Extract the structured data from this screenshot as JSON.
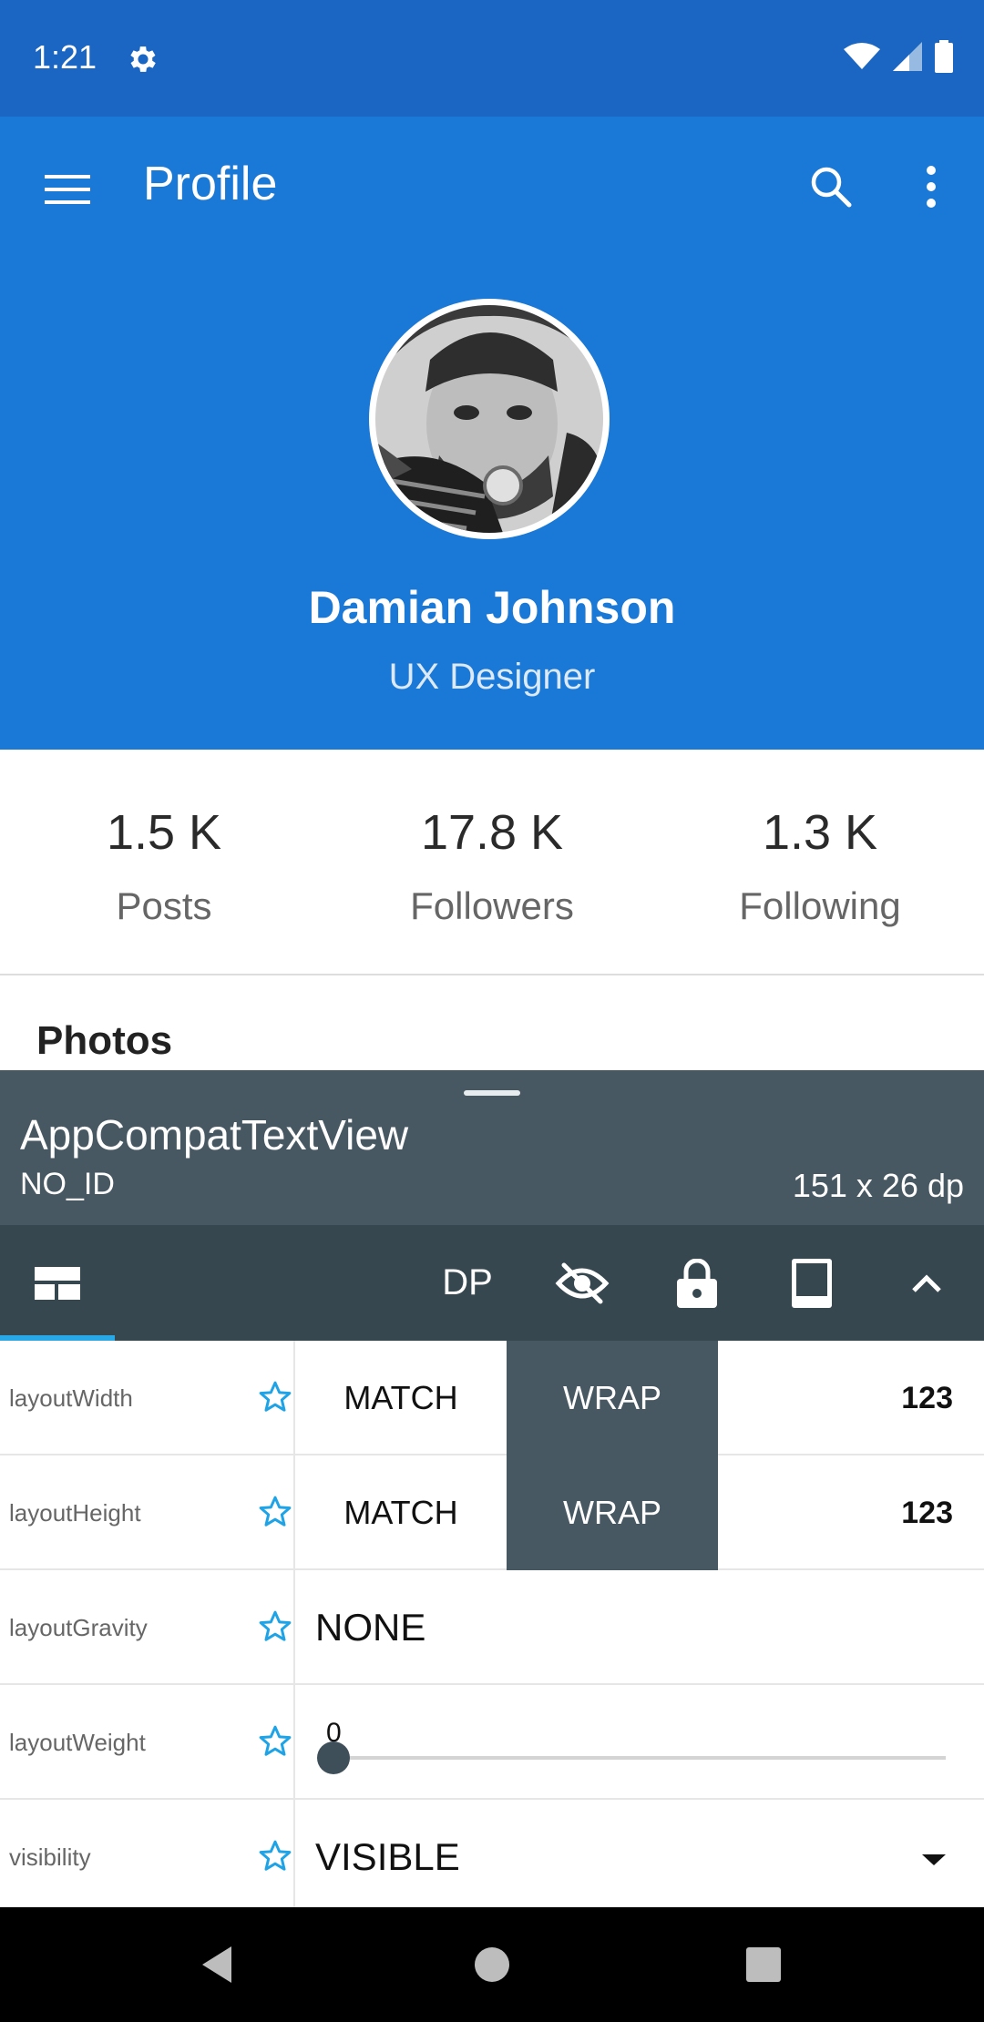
{
  "status_bar": {
    "time": "1:21"
  },
  "app_bar": {
    "title": "Profile"
  },
  "profile": {
    "name": "Damian Johnson",
    "role": "UX Designer"
  },
  "stats": [
    {
      "value": "1.5 K",
      "label": "Posts"
    },
    {
      "value": "17.8 K",
      "label": "Followers"
    },
    {
      "value": "1.3 K",
      "label": "Following"
    }
  ],
  "photos_section": {
    "title": "Photos"
  },
  "inspector": {
    "view_class": "AppCompatTextView",
    "view_id": "NO_ID",
    "view_size": "151 x 26 dp",
    "toolbar": {
      "unit_label": "DP"
    },
    "properties": [
      {
        "name": "layoutWidth",
        "match": "MATCH",
        "wrap": "WRAP",
        "numeric": "123"
      },
      {
        "name": "layoutHeight",
        "match": "MATCH",
        "wrap": "WRAP",
        "numeric": "123"
      },
      {
        "name": "layoutGravity",
        "value": "NONE"
      },
      {
        "name": "layoutWeight",
        "value": "0"
      },
      {
        "name": "visibility",
        "value": "VISIBLE"
      }
    ]
  },
  "colors": {
    "status_bar": "#1a66c2",
    "app_bar": "#1a78d6",
    "panel": "#485863",
    "toolbar": "#37474f",
    "accent": "#29a8e8"
  }
}
